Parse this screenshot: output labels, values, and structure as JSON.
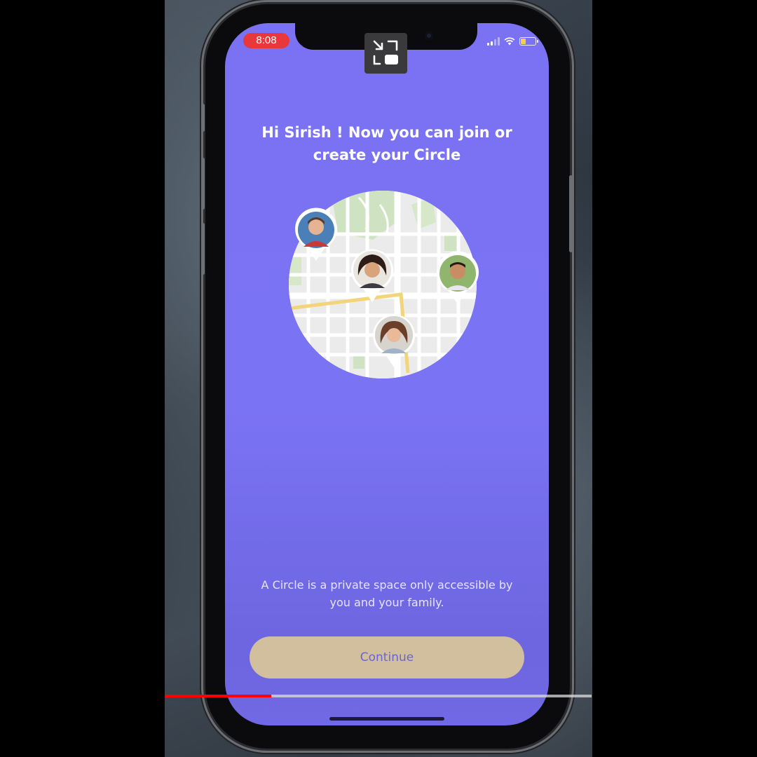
{
  "status_bar": {
    "time": "8:08",
    "time_pill_color": "#e8383b",
    "signal_icon": "cellular-signal-icon",
    "wifi_icon": "wifi-icon",
    "battery_icon": "battery-icon",
    "battery_level": 0.4,
    "battery_color": "#f3d23a"
  },
  "overlay": {
    "pip_icon": "exit-picture-in-picture-icon"
  },
  "onboarding": {
    "headline_line1": "Hi Sirish ! Now you can join or",
    "headline_line2": "create your Circle",
    "illustration": "map-circle-with-family-pins",
    "description_line1": "A Circle is a private space only accessible by",
    "description_line2": "you and your family.",
    "continue_label": "Continue"
  },
  "colors": {
    "screen_background": "#7a72f2",
    "continue_button": "#d1bf9e",
    "continue_text": "#6b66cf"
  },
  "video_player": {
    "progress": 0.25,
    "progress_color": "#ff0000"
  }
}
